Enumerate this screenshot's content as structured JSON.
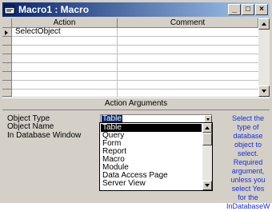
{
  "window": {
    "title": "Macro1 : Macro"
  },
  "titlebar_buttons": {
    "minimize": "_",
    "maximize": "□",
    "close": "×"
  },
  "grid": {
    "columns": [
      "Action",
      "Comment"
    ],
    "rows": [
      {
        "action": "SelectObject",
        "comment": ""
      }
    ]
  },
  "action_arguments": {
    "title": "Action Arguments",
    "labels": [
      "Object Type",
      "Object Name",
      "In Database Window"
    ],
    "object_type_value": "Table",
    "options": [
      "Table",
      "Query",
      "Form",
      "Report",
      "Macro",
      "Module",
      "Data Access Page",
      "Server View"
    ],
    "selected_option": "Table"
  },
  "help_text": [
    "Select the",
    "type of",
    "database",
    "object to",
    "select.",
    "Required",
    "argument,",
    "unless you",
    "select Yes",
    "for the",
    "InDatabaseW"
  ],
  "colors": {
    "title_start": "#0a246a",
    "title_end": "#a6caf0",
    "help_text": "#1c2fd0",
    "selection": "#000000"
  }
}
